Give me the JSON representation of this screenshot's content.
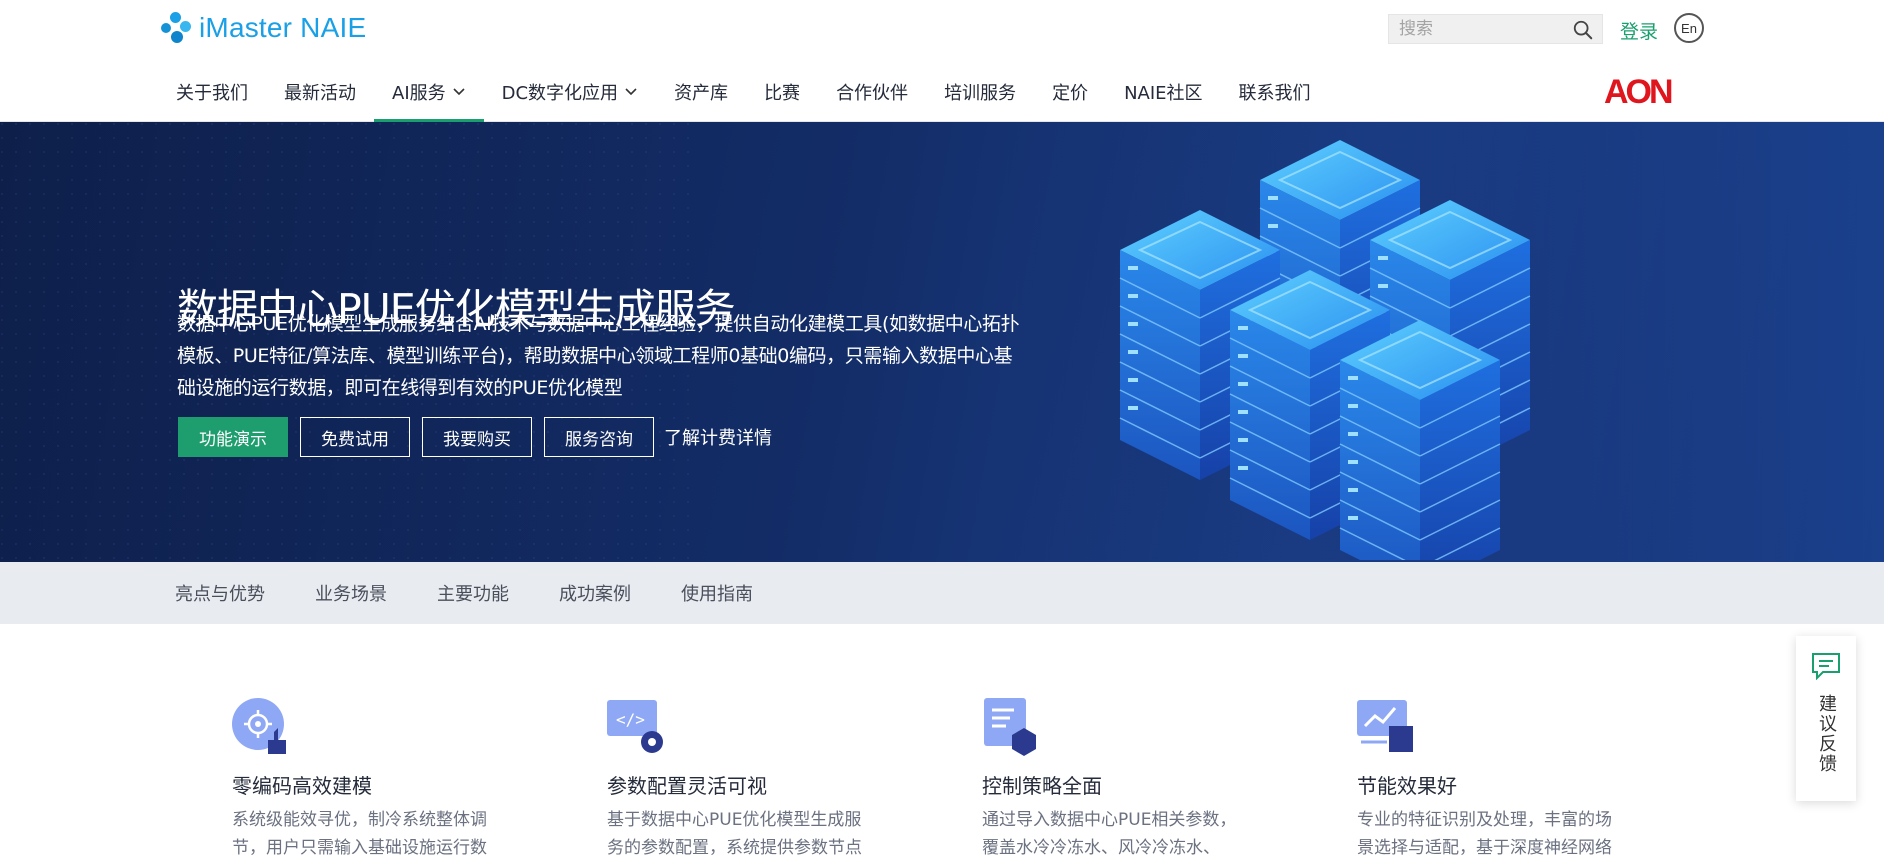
{
  "brand": {
    "name": "iMaster NAIE",
    "color": "#1aa0e6"
  },
  "header": {
    "search_placeholder": "搜索",
    "login_label": "登录",
    "lang_label": "En",
    "aon_logo": "AON"
  },
  "nav": {
    "items": [
      {
        "label": "关于我们"
      },
      {
        "label": "最新活动"
      },
      {
        "label": "AI服务",
        "dropdown": true,
        "active": true
      },
      {
        "label": "DC数字化应用",
        "dropdown": true
      },
      {
        "label": "资产库"
      },
      {
        "label": "比赛"
      },
      {
        "label": "合作伙伴"
      },
      {
        "label": "培训服务"
      },
      {
        "label": "定价"
      },
      {
        "label": "NAIE社区"
      },
      {
        "label": "联系我们"
      }
    ]
  },
  "banner": {
    "title": "数据中心PUE优化模型生成服务",
    "description": "数据中心PUE优化模型生成服务结合AI技术与数据中心工程经验，提供自动化建模工具(如数据中心拓扑模板、PUE特征/算法库、模型训练平台)，帮助数据中心领域工程师0基础0编码，只需输入数据中心基础设施的运行数据，即可在线得到有效的PUE优化模型",
    "buttons": {
      "demo": "功能演示",
      "trial": "免费试用",
      "buy": "我要购买",
      "consult": "服务咨询"
    },
    "pricing_link": "了解计费详情"
  },
  "subnav": {
    "items": [
      "亮点与优势",
      "业务场景",
      "主要功能",
      "成功案例",
      "使用指南"
    ]
  },
  "features": [
    {
      "title": "零编码高效建模",
      "desc": "系统级能效寻优，制冷系统整体调节，用户只需输入基础设施运行数",
      "icon": "target-thumb-icon"
    },
    {
      "title": "参数配置灵活可视",
      "desc": "基于数据中心PUE优化模型生成服务的参数配置，系统提供参数节点",
      "icon": "code-gear-icon"
    },
    {
      "title": "控制策略全面",
      "desc": "通过导入数据中心PUE相关参数，覆盖水冷冷冻水、风冷冷冻水、",
      "icon": "document-cube-icon"
    },
    {
      "title": "节能效果好",
      "desc": "专业的特征识别及处理，丰富的场景选择与适配，基于深度神经网络",
      "icon": "chart-monitor-icon"
    }
  ],
  "feedback": {
    "label": "建议反馈"
  },
  "colors": {
    "accent": "#1a9f6f",
    "banner_dark": "#0e1f4a",
    "subnav_bg": "#e8ebf0"
  }
}
